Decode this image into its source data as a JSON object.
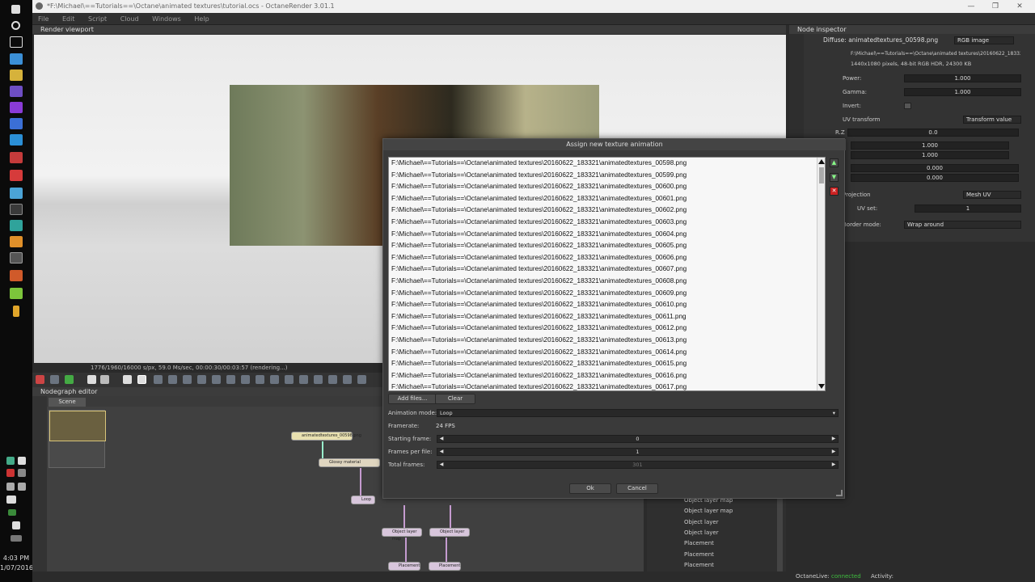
{
  "window": {
    "title": "*F:\\Michael\\==Tutorials==\\Octane\\animated textures\\tutorial.ocs - OctaneRender 3.01.1"
  },
  "menu": [
    "File",
    "Edit",
    "Script",
    "Cloud",
    "Windows",
    "Help"
  ],
  "taskbar": {
    "time": "4:03 PM",
    "date": "1/07/2016"
  },
  "viewport": {
    "title": "Render viewport",
    "status": "1776/1960/16000 s/px, 59.0 Ms/sec, 00:00:30/00:03:57 (rendering...)"
  },
  "nodegraph": {
    "title": "Nodegraph editor",
    "tab": "Scene",
    "nodes": {
      "texture": "animatedtextures_00598.png",
      "material": "Glossy material",
      "loop": "Loop",
      "olm1": "Object layer map",
      "olm2": "Object layer map",
      "place1": "Placement",
      "place2": "Placement"
    }
  },
  "inspector": {
    "title": "Node inspector",
    "node_name": "Diffuse: animatedtextures_00598.png",
    "node_type": "RGB image",
    "file_path": "F:\\Michael\\==Tutorials==\\Octane\\animated textures\\20160622_183321\\animatedtextures...",
    "file_info": "1440x1080 pixels, 48-bit RGB HDR, 24300 KB",
    "power_label": "Power:",
    "power_value": "1.000",
    "gamma_label": "Gamma:",
    "gamma_value": "1.000",
    "invert_label": "Invert:",
    "uv_label": "UV transform",
    "uv_type": "Transform value",
    "rz_label": "R.Z",
    "rz_value": "0.0",
    "s1": "1.000",
    "s2": "1.000",
    "t1": "0.000",
    "t2": "0.000",
    "projection_label": "Projection",
    "projection_value": "Mesh UV",
    "uvset_label": "UV set:",
    "uvset_value": "1",
    "border_label": "Border mode:",
    "border_value": "Wrap around"
  },
  "outliner": {
    "items": [
      "Object layer map",
      "Object layer map",
      "Object layer",
      "Object layer",
      "Placement",
      "Placement",
      "Placement"
    ]
  },
  "statusbar": {
    "octanelive_label": "OctaneLive:",
    "octanelive_value": "connected",
    "activity_label": "Activity:"
  },
  "dialog": {
    "title": "Assign new texture animation",
    "files": [
      "F:\\Michael\\==Tutorials==\\Octane\\animated textures\\20160622_183321\\animatedtextures_00598.png",
      "F:\\Michael\\==Tutorials==\\Octane\\animated textures\\20160622_183321\\animatedtextures_00599.png",
      "F:\\Michael\\==Tutorials==\\Octane\\animated textures\\20160622_183321\\animatedtextures_00600.png",
      "F:\\Michael\\==Tutorials==\\Octane\\animated textures\\20160622_183321\\animatedtextures_00601.png",
      "F:\\Michael\\==Tutorials==\\Octane\\animated textures\\20160622_183321\\animatedtextures_00602.png",
      "F:\\Michael\\==Tutorials==\\Octane\\animated textures\\20160622_183321\\animatedtextures_00603.png",
      "F:\\Michael\\==Tutorials==\\Octane\\animated textures\\20160622_183321\\animatedtextures_00604.png",
      "F:\\Michael\\==Tutorials==\\Octane\\animated textures\\20160622_183321\\animatedtextures_00605.png",
      "F:\\Michael\\==Tutorials==\\Octane\\animated textures\\20160622_183321\\animatedtextures_00606.png",
      "F:\\Michael\\==Tutorials==\\Octane\\animated textures\\20160622_183321\\animatedtextures_00607.png",
      "F:\\Michael\\==Tutorials==\\Octane\\animated textures\\20160622_183321\\animatedtextures_00608.png",
      "F:\\Michael\\==Tutorials==\\Octane\\animated textures\\20160622_183321\\animatedtextures_00609.png",
      "F:\\Michael\\==Tutorials==\\Octane\\animated textures\\20160622_183321\\animatedtextures_00610.png",
      "F:\\Michael\\==Tutorials==\\Octane\\animated textures\\20160622_183321\\animatedtextures_00611.png",
      "F:\\Michael\\==Tutorials==\\Octane\\animated textures\\20160622_183321\\animatedtextures_00612.png",
      "F:\\Michael\\==Tutorials==\\Octane\\animated textures\\20160622_183321\\animatedtextures_00613.png",
      "F:\\Michael\\==Tutorials==\\Octane\\animated textures\\20160622_183321\\animatedtextures_00614.png",
      "F:\\Michael\\==Tutorials==\\Octane\\animated textures\\20160622_183321\\animatedtextures_00615.png",
      "F:\\Michael\\==Tutorials==\\Octane\\animated textures\\20160622_183321\\animatedtextures_00616.png",
      "F:\\Michael\\==Tutorials==\\Octane\\animated textures\\20160622_183321\\animatedtextures_00617.png"
    ],
    "add_files": "Add files...",
    "clear": "Clear",
    "animation_mode_label": "Animation mode:",
    "animation_mode_value": "Loop",
    "framerate_label": "Framerate:",
    "framerate_value": "24 FPS",
    "starting_frame_label": "Starting frame:",
    "starting_frame_value": "0",
    "frames_per_file_label": "Frames per file:",
    "frames_per_file_value": "1",
    "total_frames_label": "Total frames:",
    "total_frames_value": "301",
    "ok": "Ok",
    "cancel": "Cancel"
  },
  "colors": {
    "accent": "#7fd07f",
    "connected": "#3fbf3f",
    "dialog_bg": "#3a3a3a",
    "list_bg": "#f7f7f7"
  }
}
